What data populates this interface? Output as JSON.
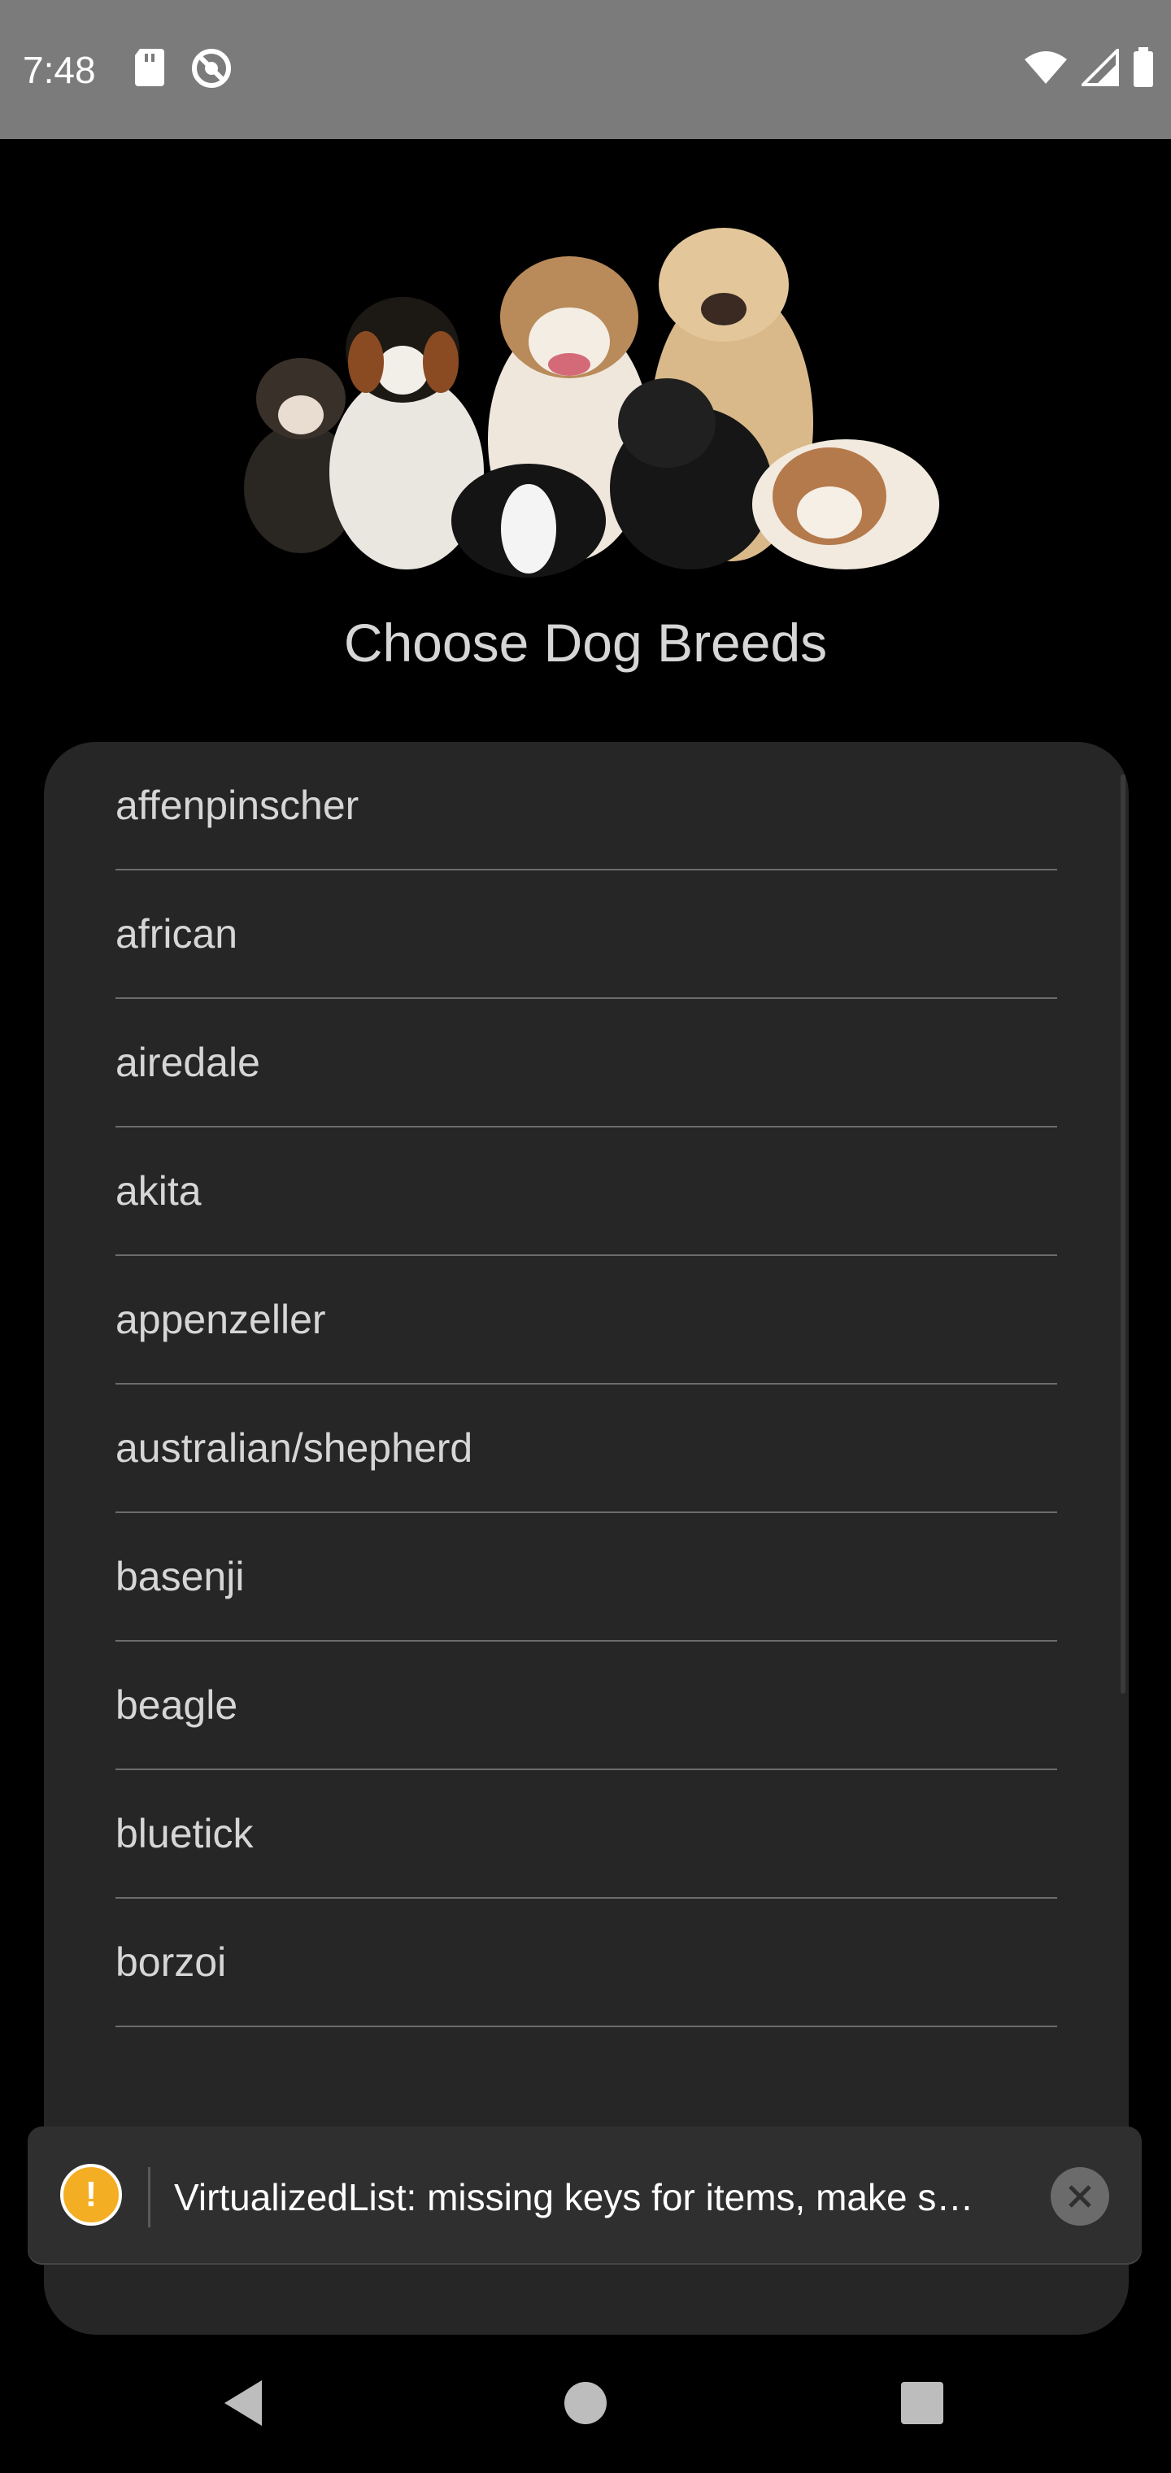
{
  "status_bar": {
    "time": "7:48",
    "icons_left": [
      "sd-card-icon",
      "no-disturb-icon"
    ],
    "icons_right": [
      "wifi-icon",
      "signal-icon",
      "battery-icon"
    ]
  },
  "header": {
    "title": "Choose Dog Breeds"
  },
  "breeds": [
    "affenpinscher",
    "african",
    "airedale",
    "akita",
    "appenzeller",
    "australian/shepherd",
    "basenji",
    "beagle",
    "bluetick",
    "borzoi"
  ],
  "toast": {
    "message": "VirtualizedList: missing keys for items, make s…",
    "accent_color": "#f4ae24"
  },
  "nav": {
    "buttons": [
      "back-icon",
      "home-icon",
      "recents-icon"
    ]
  }
}
